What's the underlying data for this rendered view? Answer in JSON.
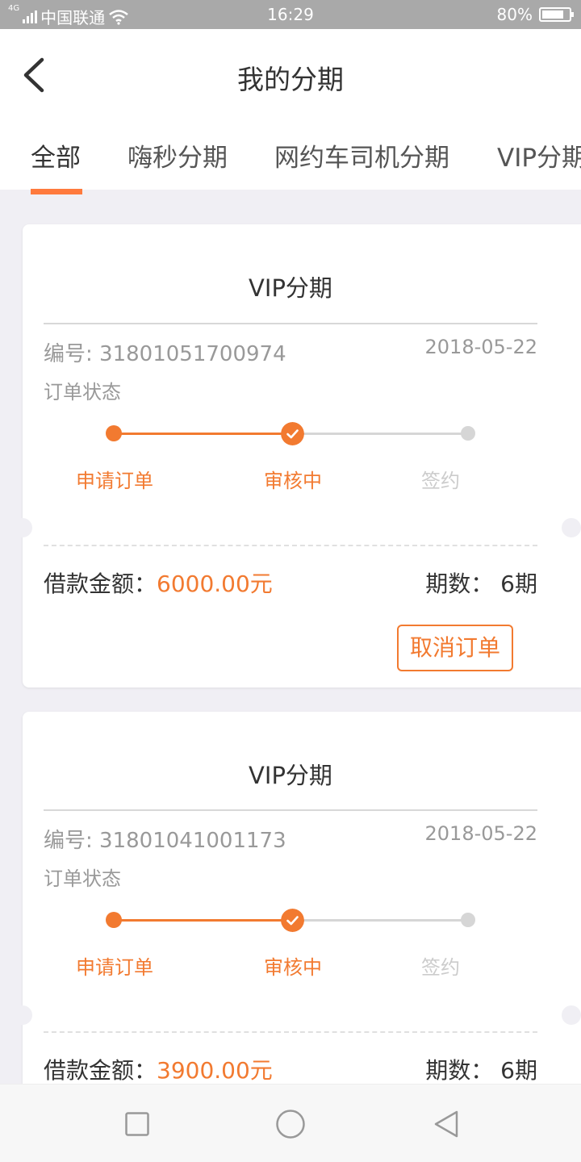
{
  "status_bar": {
    "carrier": "中国联通",
    "network": "4G",
    "time": "16:29",
    "battery": "80%",
    "battery_level": 0.8
  },
  "header": {
    "title": "我的分期",
    "back_icon": "chevron-left-icon"
  },
  "tabs": [
    "全部",
    "嗨秒分期",
    "网约车司机分期",
    "VIP分期"
  ],
  "active_tab": "全部",
  "colors": {
    "accent": "#f27a30",
    "tab_underline": "#ff7a3d",
    "inactive": "#cccccc",
    "background": "#f0eff4"
  },
  "orders": [
    {
      "title": "VIP分期",
      "number": "编号: 31801051700974",
      "date": "2018-05-22",
      "status_label": "订单状态",
      "steps": [
        "申请订单",
        "审核中",
        "签约"
      ],
      "current_step": 2,
      "amount_label": "借款金额：",
      "amount_value": "6000.00元",
      "term_label": "期数：",
      "term_value": "6期",
      "cancel_label": "取消订单"
    },
    {
      "title": "VIP分期",
      "number": "编号: 31801041001173",
      "date": "2018-05-22",
      "status_label": "订单状态",
      "steps": [
        "申请订单",
        "审核中",
        "签约"
      ],
      "current_step": 2,
      "amount_label": "借款金额：",
      "amount_value": "3900.00元",
      "term_label": "期数：",
      "term_value": "6期"
    }
  ],
  "nav_bar": {
    "icons": [
      "recent-apps-icon",
      "home-icon",
      "back-icon"
    ]
  }
}
